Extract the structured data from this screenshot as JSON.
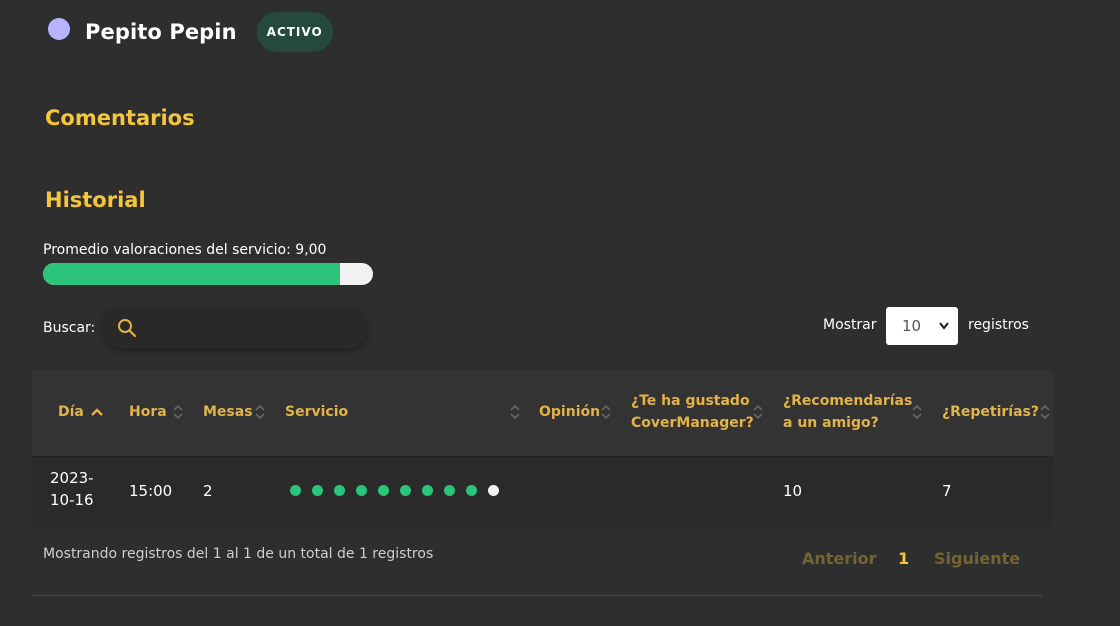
{
  "user": {
    "name": "Pepito Pepin",
    "status": "ACTIVO"
  },
  "sections": {
    "comments_title": "Comentarios",
    "history_title": "Historial"
  },
  "rating": {
    "label": "Promedio valoraciones del servicio: 9,00",
    "value": 9.0,
    "max": 10
  },
  "search": {
    "label": "Buscar:",
    "placeholder": "",
    "value": ""
  },
  "page_length": {
    "prefix": "Mostrar",
    "value": "10",
    "suffix": "registros"
  },
  "table": {
    "columns": [
      "Día",
      "Hora",
      "Mesas",
      "Servicio",
      "Opinión",
      "¿Te ha gustado CoverManager?",
      "¿Recomendarías a un amigo?",
      "¿Repetirías?"
    ],
    "sorted_column": "Día",
    "rows": [
      {
        "dia": "2023-10-16",
        "hora": "15:00",
        "mesas": "2",
        "servicio_score": 9,
        "servicio_max": 10,
        "opinion": "",
        "te_ha_gustado": "",
        "recomendarias": "10",
        "repetirias": "7"
      }
    ]
  },
  "footer": {
    "info": "Mostrando registros del 1 al 1 de un total de 1 registros",
    "prev": "Anterior",
    "page": "1",
    "next": "Siguiente"
  },
  "colors": {
    "accent": "#f5c53c",
    "header_text": "#e3b34a",
    "success": "#2cc37a",
    "badge_bg": "#254a3c",
    "avatar": "#b7b3ff"
  }
}
